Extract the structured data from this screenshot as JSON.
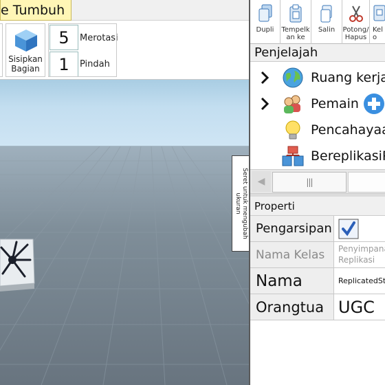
{
  "ribbon": {
    "active_tab": "e Tumbuh",
    "insert_part_label_1": "Sisipkan",
    "insert_part_label_2": "Bagian",
    "rotate_value": "5",
    "rotate_label": "Merotasi",
    "move_value": "1",
    "move_label": "Pindah"
  },
  "commands": {
    "duplicate": "Dupli",
    "paste_into_1": "Tempelk",
    "paste_into_2": "an ke",
    "copy": "Salin",
    "cut_delete_1": "Potong/",
    "cut_delete_2": "Hapus",
    "group_1": "Kel",
    "group_2": "o"
  },
  "explorer": {
    "title": "Penjelajah",
    "items": [
      {
        "label": "Ruang kerja",
        "icon": "globe-icon",
        "expandable": true
      },
      {
        "label": "Pemain",
        "icon": "players-icon",
        "expandable": true
      },
      {
        "label": "Pencahayaan",
        "icon": "lightbulb-icon",
        "expandable": false
      },
      {
        "label": "BereplikasiPenyimpanan",
        "icon": "replicated-storage-icon",
        "expandable": false
      }
    ]
  },
  "scrollbar": {
    "thumb_grip": "|||"
  },
  "drag_handle": {
    "line1": "Seret untuk mengubah",
    "line2": "ukuran"
  },
  "properties": {
    "title": "Properti",
    "archivable_label": "Pengarsipan",
    "archivable_checked": true,
    "class_name_label": "Nama Kelas",
    "class_name_value_1": "Penyimpanan",
    "class_name_value_2": "Replikasi",
    "name_label": "Nama",
    "name_value": "ReplicatedStorage",
    "parent_label": "Orangtua",
    "parent_value": "UGC"
  },
  "colors": {
    "active_tab_bg": "#fff6b6",
    "sky": "#c3def0",
    "baseplate": "#7d8c98",
    "checkbox_accent": "#2b5fb8",
    "add_icon": "#3a8fe0"
  }
}
